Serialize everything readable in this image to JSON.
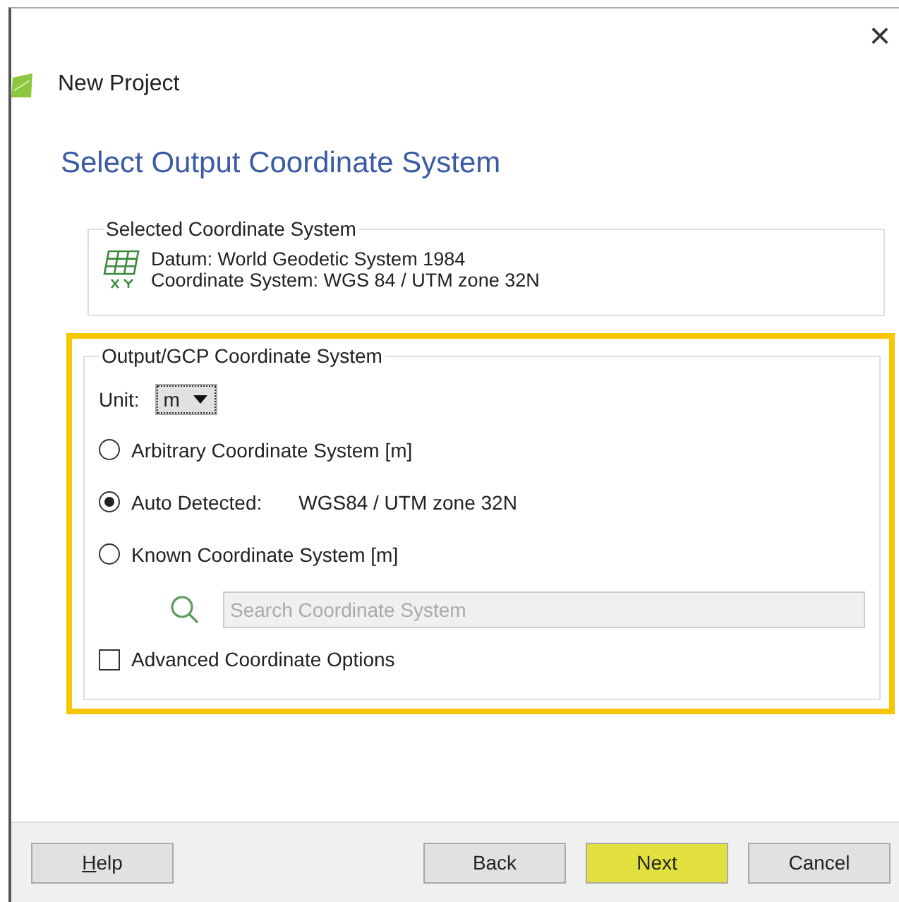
{
  "window": {
    "title": "New Project",
    "close": "×"
  },
  "heading": "Select Output Coordinate System",
  "selected_group": {
    "title": "Selected Coordinate System",
    "lines": [
      "Datum: World Geodetic System 1984",
      "Coordinate System: WGS 84 / UTM zone 32N"
    ]
  },
  "output_group": {
    "title": "Output/GCP Coordinate System",
    "highlighted": true,
    "unit_label": "Unit:",
    "unit_value": "m",
    "options": [
      {
        "label": "Arbitrary Coordinate System [m]",
        "selected": false
      },
      {
        "label": "Auto Detected:",
        "detail": "WGS84 / UTM zone 32N",
        "selected": true
      },
      {
        "label": "Known Coordinate System [m]",
        "selected": false
      }
    ],
    "search": {
      "placeholder": "Search Coordinate System",
      "disabled": true
    },
    "advanced": {
      "label": "Advanced Coordinate Options",
      "checked": false
    }
  },
  "buttons": [
    {
      "label": "Help",
      "highlighted": false
    },
    {
      "label": "Back",
      "highlighted": false
    },
    {
      "label": "Next",
      "highlighted": true
    },
    {
      "label": "Cancel",
      "highlighted": false
    }
  ]
}
